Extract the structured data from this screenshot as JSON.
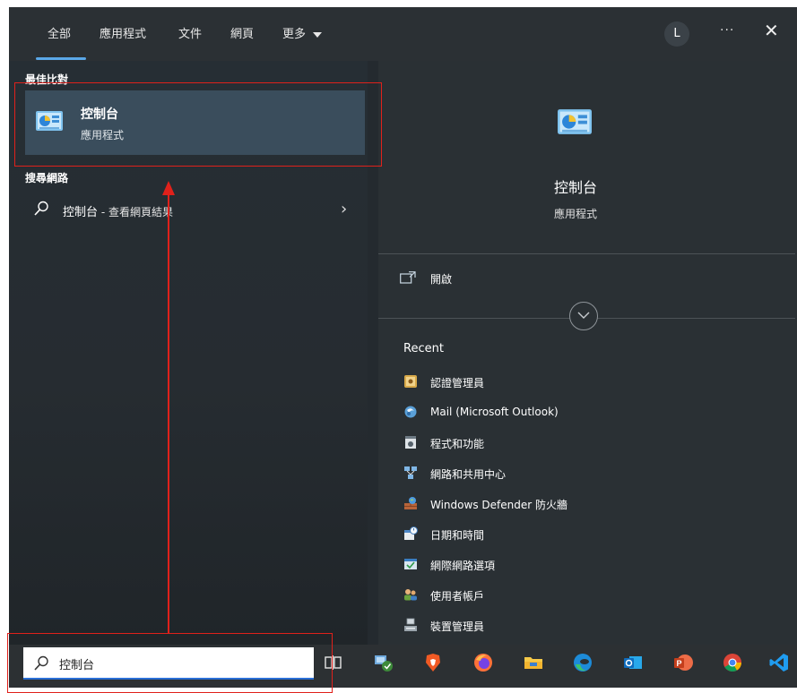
{
  "tabs": [
    {
      "label": "全部"
    },
    {
      "label": "應用程式"
    },
    {
      "label": "文件"
    },
    {
      "label": "網頁"
    },
    {
      "label": "更多"
    }
  ],
  "user_avatar_initial": "L",
  "more_options_label": "···",
  "close_label": "✕",
  "left_pane": {
    "best_match_heading": "最佳比對",
    "best_match": {
      "title": "控制台",
      "subtitle": "應用程式"
    },
    "web_heading": "搜尋網路",
    "web_result": {
      "query": "控制台",
      "suffix": " - 查看網頁結果"
    }
  },
  "preview": {
    "title": "控制台",
    "subtitle": "應用程式",
    "open_label": "開啟",
    "recent_heading": "Recent",
    "recent_items": [
      {
        "label": "認證管理員",
        "icon": "credential-manager-icon"
      },
      {
        "label": "Mail (Microsoft Outlook)",
        "icon": "mail-icon"
      },
      {
        "label": "程式和功能",
        "icon": "programs-features-icon"
      },
      {
        "label": "網路和共用中心",
        "icon": "network-sharing-icon"
      },
      {
        "label": "Windows Defender 防火牆",
        "icon": "firewall-icon"
      },
      {
        "label": "日期和時間",
        "icon": "date-time-icon"
      },
      {
        "label": "網際網路選項",
        "icon": "internet-options-icon"
      },
      {
        "label": "使用者帳戶",
        "icon": "user-accounts-icon"
      },
      {
        "label": "裝置管理員",
        "icon": "device-manager-icon"
      }
    ]
  },
  "taskbar": {
    "search_value": "控制台",
    "apps": [
      "task-view-icon",
      "network-app-icon",
      "brave-icon",
      "firefox-icon",
      "file-explorer-icon",
      "edge-icon",
      "outlook-icon",
      "powerpoint-icon",
      "chrome-icon",
      "vscode-icon"
    ]
  },
  "colors": {
    "accent": "#5aa7e8",
    "selection": "#3a4d5c",
    "annotation": "#e0211b"
  }
}
